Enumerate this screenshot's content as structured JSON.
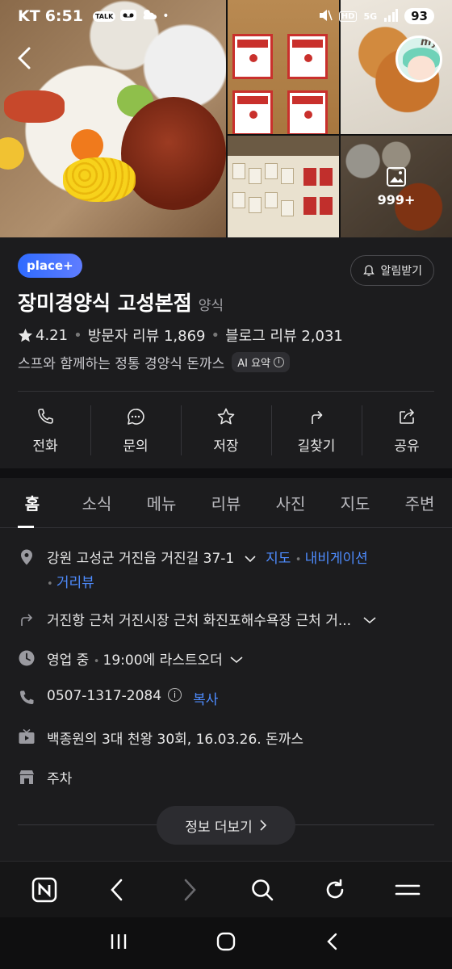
{
  "status": {
    "carrier": "KT",
    "time": "6:51",
    "chips": [
      "TALK"
    ],
    "battery": "93",
    "net": "5G"
  },
  "hero": {
    "photo_count": "999+"
  },
  "header": {
    "badge": "place+",
    "alarm_label": "알림받기",
    "title": "장미경양식 고성본점",
    "category": "양식",
    "rating": "4.21",
    "visitor_reviews": "방문자 리뷰 1,869",
    "blog_reviews": "블로그 리뷰 2,031",
    "description": "스프와 함께하는 정통 경양식 돈까스",
    "ai_summary": "AI 요약"
  },
  "actions": [
    {
      "label": "전화",
      "icon": "phone-icon"
    },
    {
      "label": "문의",
      "icon": "chat-bubble-icon"
    },
    {
      "label": "저장",
      "icon": "star-icon"
    },
    {
      "label": "길찾기",
      "icon": "directions-icon"
    },
    {
      "label": "공유",
      "icon": "share-icon"
    }
  ],
  "tabs": [
    "홈",
    "소식",
    "메뉴",
    "리뷰",
    "사진",
    "지도",
    "주변"
  ],
  "details": {
    "address": "강원 고성군 거진읍 거진길 37-1",
    "map_link": "지도",
    "navi_link": "내비게이션",
    "street_view_link": "거리뷰",
    "nearby": "거진항 근처 거진시장 근처 화진포해수욕장 근처 거...",
    "hours_status": "영업 중",
    "hours_detail": "19:00에 라스트오더",
    "phone": "0507-1317-2084",
    "copy_label": "복사",
    "tv": "백종원의 3대 천왕 30회, 16.03.26. 돈까스",
    "parking": "주차",
    "more_info": "정보 더보기"
  },
  "colors": {
    "background": "#1c1c1e",
    "link": "#4e8cff",
    "badge": "#2f6bff"
  }
}
